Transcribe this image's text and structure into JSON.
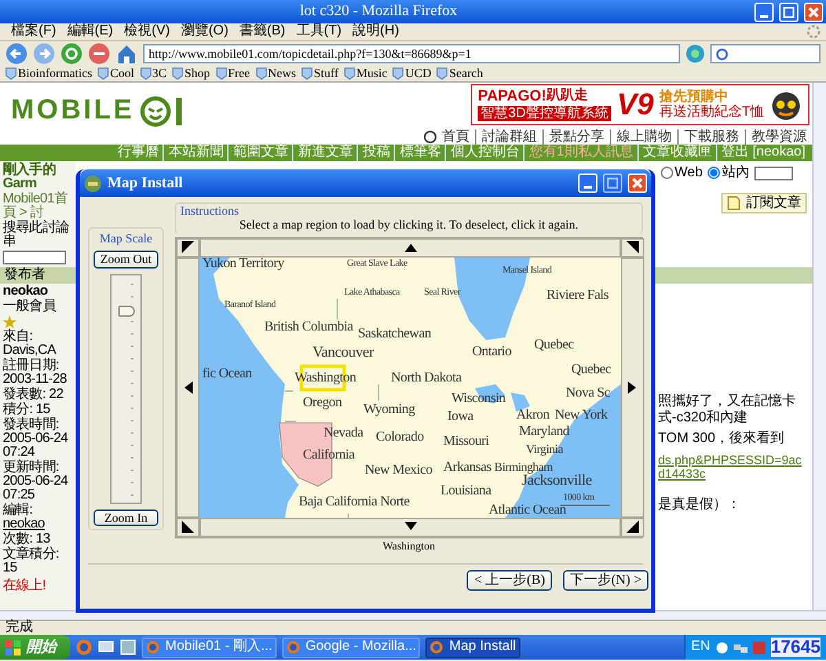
{
  "window": {
    "title": "lot c320 - Mozilla Firefox"
  },
  "menu": [
    "檔案(F)",
    "編輯(E)",
    "檢視(V)",
    "瀏覽(O)",
    "書籤(B)",
    "工具(T)",
    "說明(H)"
  ],
  "address": {
    "value": "http://www.mobile01.com/topicdetail.php?f=130&t=86689&p=1"
  },
  "bookmarks": [
    "Bioinformatics",
    "Cool",
    "3C",
    "Shop",
    "Free",
    "News",
    "Stuff",
    "Music",
    "UCD",
    "Search"
  ],
  "page": {
    "logo_text": "MOBILE",
    "banner": {
      "brand": "PAPAGO!",
      "brand_cn": "趴趴走",
      "version": "V9",
      "tagline": "智慧3D聲控導航系統",
      "promo": "搶先預購中",
      "note": "再送活動紀念T恤"
    },
    "nav": [
      "首頁",
      "討論群組",
      "景點分享",
      "線上購物",
      "下載服務",
      "教學資源"
    ],
    "toolbar_links": [
      {
        "label": "行事曆",
        "alert": false
      },
      {
        "label": "本站新聞",
        "alert": false
      },
      {
        "label": "範圍文章",
        "alert": false
      },
      {
        "label": "新進文章",
        "alert": false
      },
      {
        "label": "投稿",
        "alert": false
      },
      {
        "label": "標筆客",
        "alert": false
      },
      {
        "label": "個人控制台",
        "alert": false
      },
      {
        "label": "您有1則私人訊息",
        "alert": true
      },
      {
        "label": "文章收藏匣",
        "alert": false
      },
      {
        "label": "登出 [neokao]",
        "alert": false
      }
    ],
    "topic_title": "剛入手的Garm",
    "breadcrumb": "Mobile01首頁 > 討",
    "search_label": "搜尋此討論串",
    "poster_header": "發布者",
    "user": {
      "name": "neokao",
      "rank": "一般會員",
      "fields": [
        "來自: Davis,CA",
        "註冊日期: 2003-11-28",
        "發表數: 22",
        "積分: 15"
      ],
      "post_fields": [
        "發表時間: 2005-06-24 07:24",
        "更新時間: 2005-06-24 07:25"
      ],
      "edit_label": "編輯:",
      "editor": "neokao",
      "count": "次數: 13",
      "score": "文章積分: 15",
      "online": "在線上!"
    },
    "search_scope": [
      {
        "label": "Web",
        "selected": false
      },
      {
        "label": "站內",
        "selected": true
      }
    ],
    "subscribe": "訂閱文章",
    "post_lines": [
      "照攜好了，又在記憶卡式-c320和內建",
      "TOM 300，後來看到"
    ],
    "link": "ds.php&PHPSESSID=9acd14433c",
    "post_tail": "是真是假）："
  },
  "dialog": {
    "title": "Map Install",
    "instructions_label": "Instructions",
    "instructions": "Select a map region to load by clicking it. To deselect, click it again.",
    "scale_label": "Map Scale",
    "zoom_out": "Zoom Out",
    "zoom_in": "Zoom In",
    "scale": {
      "level": 0.87
    },
    "map_labels": [
      "Yukon Territory",
      "Great Slave Lake",
      "Mansel Island",
      "Lake Athabasca",
      "Seal River",
      "Riviere Fals",
      "Baranof Island",
      "British Columbia",
      "Saskatchewan",
      "Vancouver",
      "Ontario",
      "Quebec",
      "fic Ocean",
      "Washington",
      "North Dakota",
      "Quebec",
      "Nova Sc",
      "Oregon",
      "Wyoming",
      "Wisconsin",
      "Iowa",
      "Akron",
      "New York",
      "Nevada",
      "Colorado",
      "Missouri",
      "Maryland",
      "California",
      "Virginia",
      "New Mexico",
      "Arkansas",
      "Birmingham",
      "Louisiana",
      "Jacksonville",
      "1000 km",
      "Baja California Norte",
      "Atlantic Ocean"
    ],
    "selected_region": "Washington",
    "back": "< 上一步(B)",
    "next": "下一步(N) >"
  },
  "status_bar": "完成",
  "taskbar": {
    "start": "開始",
    "tasks": [
      {
        "label": "Mobile01 - 剛入...",
        "selected": false
      },
      {
        "label": "Google - Mozilla...",
        "selected": false
      },
      {
        "label": "Map Install",
        "selected": true
      }
    ],
    "language": "EN",
    "counter": "17645"
  }
}
